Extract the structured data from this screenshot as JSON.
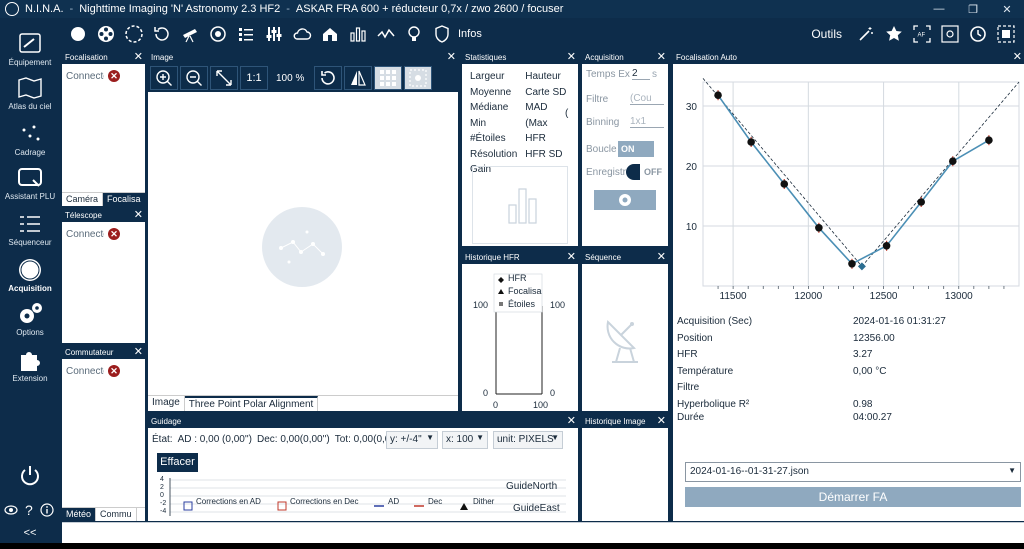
{
  "title_bar": {
    "app_name": "N.I.N.A.",
    "title": "Nighttime Imaging 'N' Astronomy 2.3 HF2",
    "profile": "ASKAR FRA 600 + réducteur 0,7x / zwo 2600 / focuser",
    "minimize": "—",
    "maximize": "❐",
    "close": "✕"
  },
  "toolbar": {
    "infos_label": "Infos",
    "outils_label": "Outils",
    "icons": [
      "camera-icon",
      "filter-wheel-icon",
      "filter-icon",
      "rotator-icon",
      "telescope-icon",
      "focuser-icon",
      "switch-icon",
      "equalizer-icon",
      "cloud-icon",
      "dome-icon",
      "chart-icon",
      "graph-icon",
      "bulb-icon",
      "shield-icon"
    ]
  },
  "sidebar": {
    "items": [
      {
        "label": "Équipement",
        "icon": "telescope-icon"
      },
      {
        "label": "Atlas du ciel",
        "icon": "map-icon"
      },
      {
        "label": "Cadrage",
        "icon": "stars-icon"
      },
      {
        "label": "Assistant PLU",
        "icon": "flat-icon"
      },
      {
        "label": "Séquenceur",
        "icon": "list-icon"
      },
      {
        "label": "Acquisition",
        "icon": "aperture-icon"
      },
      {
        "label": "Options",
        "icon": "gears-icon"
      },
      {
        "label": "Extension",
        "icon": "puzzle-icon"
      }
    ],
    "collapse": "<<"
  },
  "focalisation_panel": {
    "title": "Focalisation",
    "connect_text": "Connecté",
    "tabs": [
      "Caméra",
      "Focalisa"
    ]
  },
  "telescope_panel": {
    "title": "Télescope",
    "connect_text": "Connecté"
  },
  "commutateur_panel": {
    "title": "Commutateur",
    "connect_text": "Connecté",
    "tabs": [
      "Météo",
      "Commu"
    ]
  },
  "image_panel": {
    "title": "Image",
    "zoom_one": "1:1",
    "zoom_percent": "100 %",
    "tabs": [
      "Image",
      "Three Point Polar Alignment"
    ]
  },
  "statistiques_panel": {
    "title": "Statistiques",
    "col1": [
      "Largeur",
      "Moyenne",
      "Médiane",
      "Min",
      "#Étoiles",
      "Résolution",
      "Gain"
    ],
    "col2": [
      "Hauteur",
      "Carte SD",
      "MAD",
      "(Max",
      "HFR",
      "HFR SD",
      ""
    ],
    "col3": [
      "",
      "",
      "",
      "(",
      "",
      "",
      ""
    ]
  },
  "acquisition_panel": {
    "title": "Acquisition",
    "temps_label": "Temps Ex",
    "temps_value": "2",
    "temps_unit": "s",
    "filtre_label": "Filtre",
    "filtre_value": "(Cou",
    "binning_label": "Binning",
    "binning_value": "1x1",
    "boucle_label": "Boucle",
    "boucle_value": "ON",
    "enregistrer_label": "Enregistre",
    "enregistrer_value": "OFF"
  },
  "historique_hfr_panel": {
    "title": "Historique HFR",
    "legend": [
      "HFR",
      "Focalisa",
      "Étoiles"
    ],
    "y_left_top": "100",
    "y_left_bottom": "0",
    "y_right_top": "100",
    "y_right_bottom": "0",
    "x_left": "0",
    "x_right": "100"
  },
  "sequence_panel": {
    "title": "Séquence"
  },
  "historique_image_panel": {
    "title": "Historique Image"
  },
  "guidage_panel": {
    "title": "Guidage",
    "etat_label": "État:",
    "ad_text": "AD : 0,00 (0,00'')",
    "dec_text": "Dec: 0,00(0,00'')",
    "tot_text": "Tot: 0,00(0,00'')",
    "y_select": "y: +/-4\"",
    "x_select": "x: 100",
    "unit_select": "unit: PIXELS",
    "effacer_label": "Effacer",
    "y_ticks": [
      "4",
      "2",
      "0",
      "-2",
      "-4"
    ],
    "legend": [
      "Corrections en AD",
      "Corrections en Dec",
      "AD",
      "Dec",
      "Dither"
    ],
    "guide_north": "GuideNorth",
    "guide_east": "GuideEast",
    "colors": {
      "ad": "#2b3fa0",
      "dec": "#c0392b"
    }
  },
  "focalisation_auto_panel": {
    "title": "Focalisation Auto",
    "info": [
      {
        "key": "Acquisition (Sec)",
        "value": "2024-01-16 01:31:27"
      },
      {
        "key": "Position",
        "value": "12356.00"
      },
      {
        "key": "HFR",
        "value": "3.27"
      },
      {
        "key": "Température",
        "value": "0,00 °C"
      },
      {
        "key": "Filtre",
        "value": ""
      },
      {
        "key": "Hyperbolique R²",
        "value": "0.98"
      },
      {
        "key": "Durée",
        "value": "04:00.27"
      }
    ],
    "file_select": "2024-01-16--01-31-27.json",
    "start_button": "Démarrer FA"
  },
  "chart_data": {
    "type": "scatter",
    "title": "",
    "xlabel": "",
    "ylabel": "",
    "xlim": [
      11300,
      13400
    ],
    "ylim": [
      0,
      34
    ],
    "x_ticks": [
      11500,
      12000,
      12500,
      13000
    ],
    "y_ticks": [
      10,
      20,
      30
    ],
    "grid": true,
    "series": [
      {
        "values": [
          {
            "x": 11400,
            "y": 31.8
          },
          {
            "x": 11620,
            "y": 24.0
          },
          {
            "x": 11840,
            "y": 17.0
          },
          {
            "x": 12070,
            "y": 9.7
          },
          {
            "x": 12290,
            "y": 3.7
          },
          {
            "x": 12520,
            "y": 6.7
          },
          {
            "x": 12750,
            "y": 14.0
          },
          {
            "x": 12960,
            "y": 20.8
          },
          {
            "x": 13200,
            "y": 24.3
          }
        ]
      }
    ],
    "best_focus": {
      "x": 12356,
      "y": 3.27
    }
  }
}
